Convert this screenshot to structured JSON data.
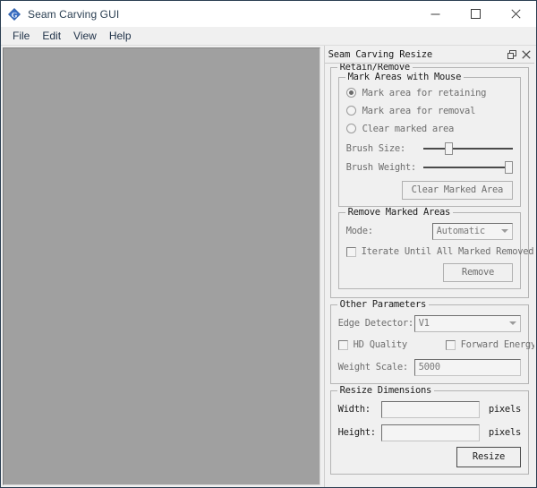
{
  "window": {
    "title": "Seam Carving GUI",
    "icon": "app-logo-icon",
    "controls": {
      "minimize": "minimize-icon",
      "maximize": "maximize-icon",
      "close": "close-icon"
    }
  },
  "menu": {
    "items": [
      {
        "label": "File"
      },
      {
        "label": "Edit"
      },
      {
        "label": "View"
      },
      {
        "label": "Help"
      }
    ]
  },
  "canvas": {
    "name": "image-canvas",
    "background_color": "#a0a0a0"
  },
  "dock": {
    "title": "Seam Carving Resize",
    "float_icon": "float-window-icon",
    "close_icon": "close-icon",
    "groups": {
      "retain_remove": {
        "title": "Retain/Remove",
        "mark_areas": {
          "title": "Mark Areas with Mouse",
          "radios": [
            {
              "label": "Mark area for retaining",
              "checked": true
            },
            {
              "label": "Mark area for removal",
              "checked": false
            },
            {
              "label": "Clear marked area",
              "checked": false
            }
          ],
          "sliders": [
            {
              "label": "Brush Size:",
              "value_pct": 25
            },
            {
              "label": "Brush Weight:",
              "value_pct": 100
            }
          ],
          "clear_button": "Clear Marked Area"
        },
        "remove_marked": {
          "title": "Remove Marked Areas",
          "mode_label": "Mode:",
          "mode_value": "Automatic",
          "iterate_checkbox": "Iterate Until All Marked Removed",
          "remove_button": "Remove"
        }
      },
      "other_parameters": {
        "title": "Other Parameters",
        "edge_detector_label": "Edge Detector:",
        "edge_detector_value": "V1",
        "hd_quality_checkbox": "HD Quality",
        "forward_energy_checkbox": "Forward Energy",
        "weight_scale_label": "Weight Scale:",
        "weight_scale_value": "5000"
      },
      "resize_dimensions": {
        "title": "Resize Dimensions",
        "width_label": "Width:",
        "width_value": "",
        "width_unit": "pixels",
        "height_label": "Height:",
        "height_value": "",
        "height_unit": "pixels",
        "resize_button": "Resize"
      }
    }
  }
}
